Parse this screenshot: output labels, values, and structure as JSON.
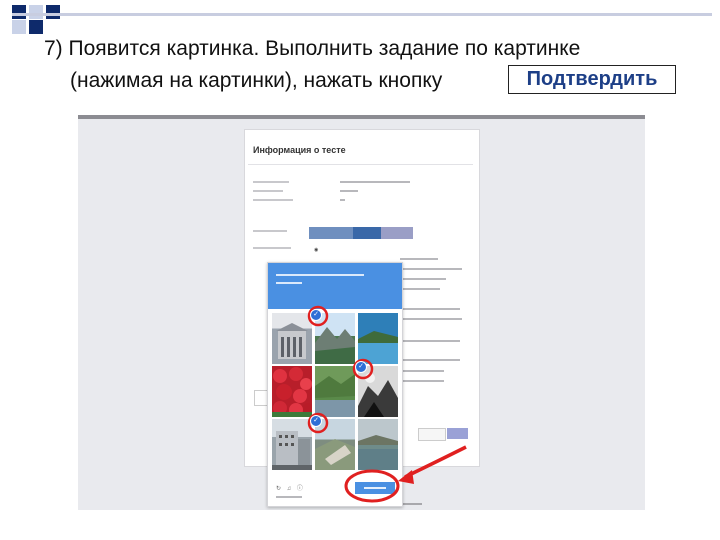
{
  "slide": {
    "line1": "7) Появится картинка. Выполнить задание по картинке",
    "line2": "(нажимая на картинки), нажать кнопку",
    "confirm_label": "Подтвердить"
  },
  "screenshot": {
    "panel_title": "Информация о тесте",
    "tabs": [
      "",
      "",
      ""
    ],
    "sidebar_rows": [
      "",
      "",
      "",
      "",
      "",
      ""
    ],
    "captcha": {
      "title": "",
      "confirm_label": "",
      "link": "",
      "icons": [
        "refresh-icon",
        "audio-icon",
        "info-icon"
      ]
    },
    "buttons": {
      "next": "",
      "send": ""
    }
  },
  "colors": {
    "accent": "#4a90e2",
    "title_blue": "#1d3f87",
    "annotation_red": "#e02020",
    "square_dark": "#0e2a6b",
    "square_light": "#c9d2e8"
  }
}
